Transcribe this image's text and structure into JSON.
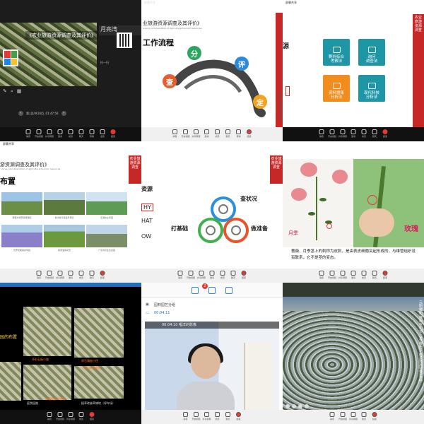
{
  "toolbar": {
    "items": [
      "静音",
      "开启视频",
      "共享屏幕",
      "邀请",
      "成员",
      "聊天",
      "录制",
      "设置",
      "结束"
    ]
  },
  "cells": {
    "r0c0": {
      "slide_title": "《农业旅游资源调查及其评价》",
      "banner": "月亮湾",
      "tag": "扫一扫",
      "pager": "第1页/共10页 ,01:47:56"
    },
    "r0c1": {
      "window_title": "屏幕共享",
      "header": "业旅游资源调查及其评价》",
      "header_sub": "survey and evaluation of agricultural tourism resources",
      "flow_title": "工作流程",
      "nodes": [
        "查",
        "分",
        "评",
        "定"
      ]
    },
    "r0c2": {
      "window_title": "屏幕共享",
      "side_text": "源",
      "band_text": "农业旅游资源调查",
      "tiles": [
        "野外综合\n考察法",
        "询问\n调查法",
        "资料搜集\n分析法",
        "现代科技\n分析法"
      ]
    },
    "r1c0": {
      "window_title": "屏幕共享",
      "header": "游资源调查及其评价》",
      "header_sub": "survey and evaluation of agricultural tourism resources",
      "band_text": "农业旅游资源调查",
      "big_text": "布置",
      "captions": [
        "赛里木湖草原旅游区",
        "贵州省平塘县风景区",
        "东湖水上乐园",
        "普罗旺斯薰衣草园",
        "婺源油菜花田",
        "广东省农业生态园"
      ]
    },
    "r1c1": {
      "side_texts": [
        "资源",
        "HY",
        "HAT",
        "OW"
      ],
      "band_text": "农业旅游资源调查",
      "labels": [
        "查状况",
        "打基础",
        "做准备"
      ]
    },
    "r1c2": {
      "label_a": "月季",
      "label_b": "玫瑰",
      "caption": "蔷薇、月季茎上的刺称为皮刺，是由表皮细胞突起形成的，与维管组织没有联系，它不是茎的变态。"
    },
    "r2c0": {
      "y_text": "园的布置",
      "labels": [
        "环形石板小路",
        "卵石镶嵌小径",
        "庭院园路",
        "条石嵌草铺地",
        "冰裂纹嵌草铺地",
        "植草砖嵌草铺地（停车场）"
      ]
    },
    "r2c1": {
      "badge": "2",
      "row1": "园林园艺分组",
      "row2": "00:04:11",
      "video_label": "00:04:10   唱洋的影像"
    },
    "r2c2": {
      "poem": "元阳梯田 梯田在山顶 云在梯田下 哈尼族的智慧在此"
    }
  }
}
